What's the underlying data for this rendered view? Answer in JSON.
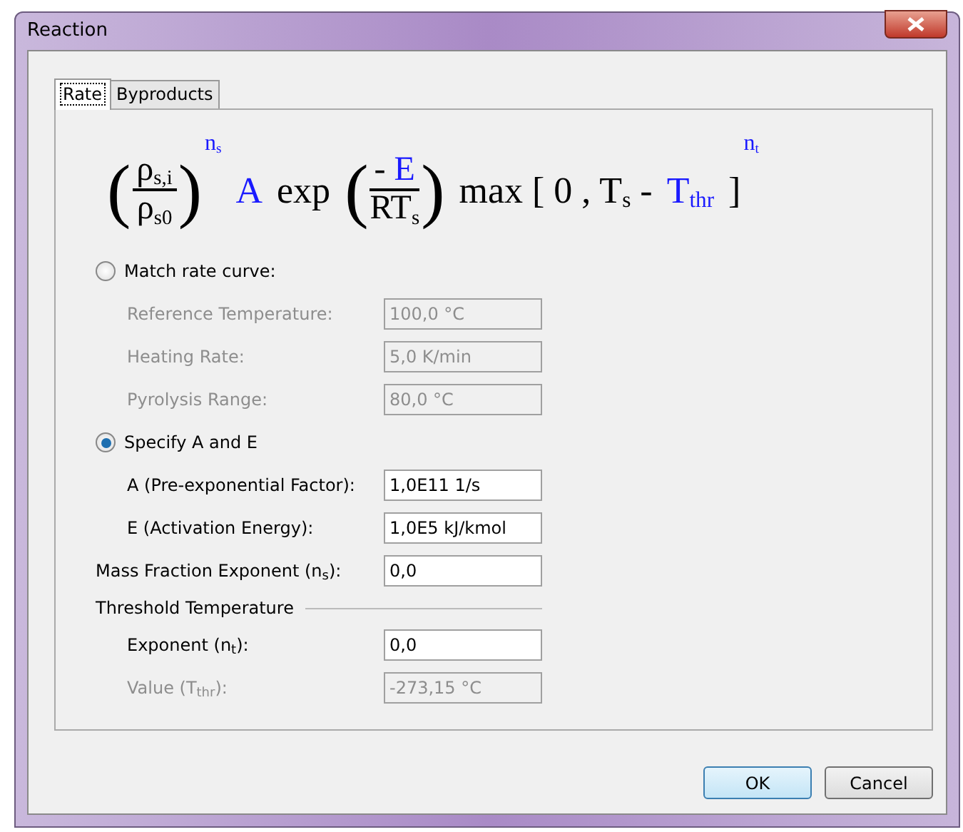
{
  "window": {
    "title": "Reaction"
  },
  "tabs": [
    {
      "label": "Rate",
      "selected": true
    },
    {
      "label": "Byproducts",
      "selected": false
    }
  ],
  "formula": [
    {
      "kind": "fraction",
      "open": "(",
      "close": ")",
      "numerator": [
        {
          "text": "ρ$_{s,i}$",
          "color": "#000000"
        }
      ],
      "denominator": [
        {
          "text": "ρ$_{s0}$",
          "color": "#000000"
        }
      ]
    },
    {
      "kind": "sup",
      "text": "n$_{s}$",
      "color": "#1a1aff"
    },
    {
      "kind": "text",
      "text": "A",
      "color": "#1a1aff"
    },
    {
      "kind": "text",
      "text": "exp",
      "color": "#000000"
    },
    {
      "kind": "fraction",
      "open": "(",
      "close": ")",
      "numerator": [
        {
          "text": "-",
          "color": "#000000"
        },
        {
          "text": "E",
          "color": "#1a1aff"
        }
      ],
      "denominator": [
        {
          "text": "RT$_{s}$",
          "color": "#000000"
        }
      ]
    },
    {
      "kind": "text",
      "text": "max [ 0 , T$_{s}$ -",
      "color": "#000000"
    },
    {
      "kind": "text",
      "text": "T$_{thr}$",
      "color": "#1a1aff"
    },
    {
      "kind": "text",
      "text": "]",
      "color": "#000000"
    },
    {
      "kind": "sup",
      "text": "n$_{t}$",
      "color": "#1a1aff"
    }
  ],
  "form": [
    {
      "kind": "radio",
      "label": "Match rate curve:",
      "selected": false,
      "children": [
        {
          "kind": "field",
          "label": "Reference Temperature:",
          "value": "100,0 °C",
          "disabled": true
        },
        {
          "kind": "field",
          "label": "Heating Rate:",
          "value": "5,0 K/min",
          "disabled": true
        },
        {
          "kind": "field",
          "label": "Pyrolysis Range:",
          "value": "80,0 °C",
          "disabled": true
        }
      ]
    },
    {
      "kind": "radio",
      "label": "Specify A and E",
      "selected": true,
      "children": [
        {
          "kind": "field",
          "label": "A (Pre-exponential Factor):",
          "value": "1,0E11 1/s",
          "disabled": false
        },
        {
          "kind": "field",
          "label": "E (Activation Energy):",
          "value": "1,0E5 kJ/kmol",
          "disabled": false
        }
      ]
    },
    {
      "kind": "field",
      "label": "Mass Fraction Exponent (n$_{s}$):",
      "value": "0,0",
      "disabled": false
    },
    {
      "kind": "section",
      "label": "Threshold Temperature",
      "children": [
        {
          "kind": "field",
          "label": "Exponent (n$_{t}$):",
          "value": "0,0",
          "disabled": false
        },
        {
          "kind": "field",
          "label": "Value (T$_{thr}$):",
          "value": "-273,15 °C",
          "disabled": true
        }
      ]
    }
  ],
  "buttons": [
    {
      "label": "OK",
      "default": true
    },
    {
      "label": "Cancel",
      "default": false
    }
  ]
}
